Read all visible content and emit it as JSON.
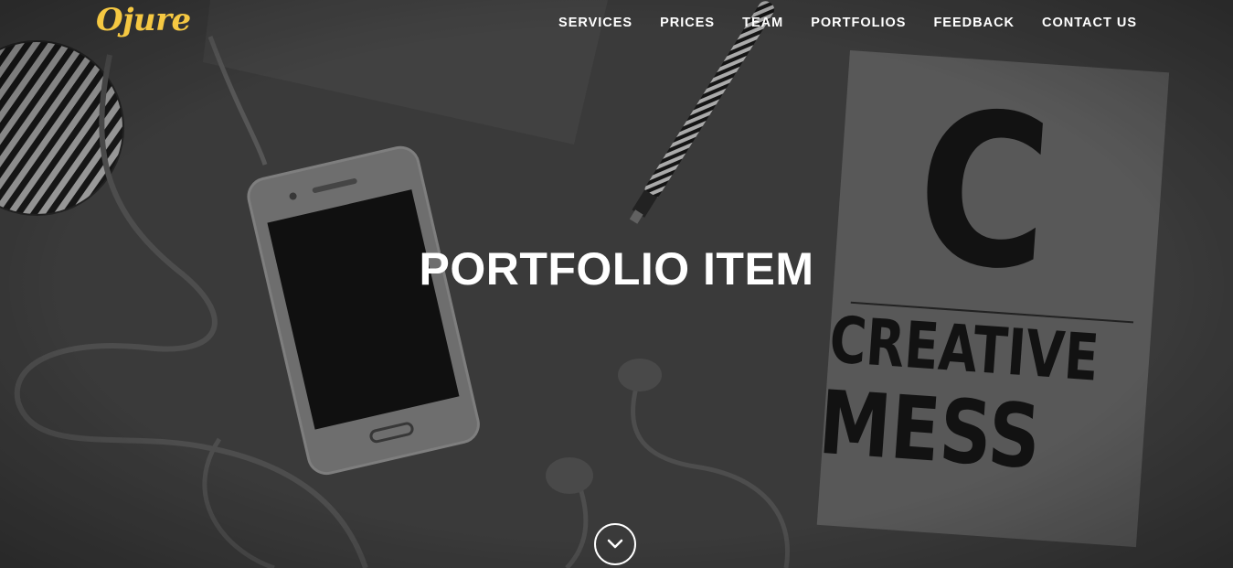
{
  "brand": {
    "name": "Ojure",
    "color": "#f5c842"
  },
  "nav": {
    "items": [
      {
        "label": "SERVICES"
      },
      {
        "label": "PRICES"
      },
      {
        "label": "TEAM"
      },
      {
        "label": "PORTFOLIOS"
      },
      {
        "label": "FEEDBACK"
      },
      {
        "label": "CONTACT US"
      }
    ]
  },
  "hero": {
    "title": "PORTFOLIO ITEM",
    "scroll_icon": "chevron-down-icon",
    "book_letter": "C",
    "book_line1": "CREATIVE",
    "book_line2": "MESS"
  }
}
